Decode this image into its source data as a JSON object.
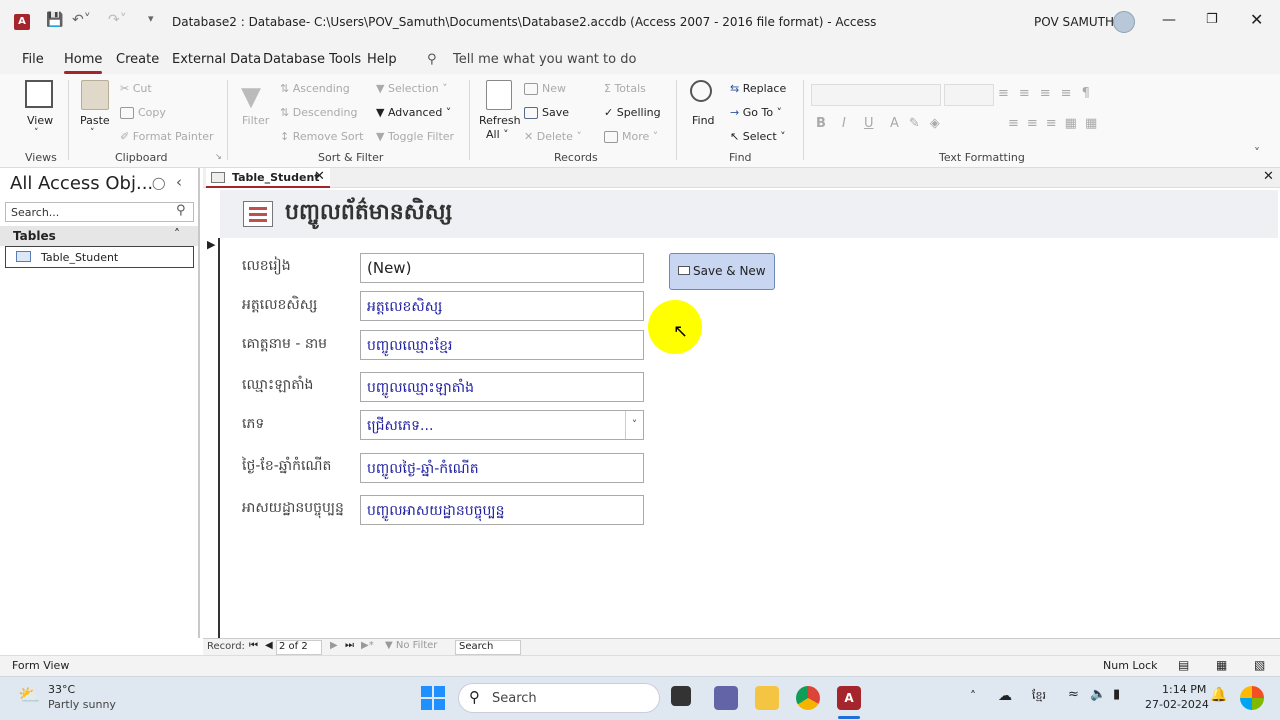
{
  "app": {
    "title": "Database2 : Database- C:\\Users\\POV_Samuth\\Documents\\Database2.accdb (Access 2007 - 2016 file format)  -  Access",
    "user": "POV SAMUTH",
    "icon_letter": "A"
  },
  "menu": {
    "items": [
      "File",
      "Home",
      "Create",
      "External Data",
      "Database Tools",
      "Help"
    ],
    "tell_me": "Tell me what you want to do"
  },
  "ribbon": {
    "views": {
      "view": "View",
      "group": "Views"
    },
    "clipboard": {
      "paste": "Paste",
      "cut": "Cut",
      "copy": "Copy",
      "format_painter": "Format Painter",
      "group": "Clipboard"
    },
    "sort_filter": {
      "filter": "Filter",
      "ascending": "Ascending",
      "descending": "Descending",
      "remove_sort": "Remove Sort",
      "selection": "Selection",
      "advanced": "Advanced",
      "toggle_filter": "Toggle Filter",
      "group": "Sort & Filter"
    },
    "records": {
      "refresh": "Refresh",
      "refresh_all": "All",
      "new": "New",
      "save": "Save",
      "delete": "Delete",
      "totals": "Totals",
      "spelling": "Spelling",
      "more": "More",
      "group": "Records"
    },
    "find": {
      "find": "Find",
      "replace": "Replace",
      "go_to": "Go To",
      "select": "Select",
      "group": "Find"
    },
    "text_formatting": {
      "group": "Text Formatting",
      "bold": "B",
      "italic": "I",
      "underline": "U"
    }
  },
  "nav": {
    "title": "All Access Obj...",
    "search_placeholder": "Search...",
    "section": "Tables",
    "items": [
      "Table_Student"
    ]
  },
  "document": {
    "tab": "Table_Student",
    "form_title": "បញ្ចូលព័ត៌មានសិស្ស"
  },
  "form": {
    "fields": [
      {
        "label": "លេខរៀង",
        "value": "(New)"
      },
      {
        "label": "អត្តលេខសិស្ស",
        "value": "អត្តលេខសិស្ស"
      },
      {
        "label": "គោត្តនាម - នាម",
        "value": "បញ្ចូលឈ្មោះខ្មែរ"
      },
      {
        "label": "ឈ្មោះឡាតាំង",
        "value": "បញ្ចូលឈ្មោះឡាតាំង"
      },
      {
        "label": "ភេទ",
        "value": "ជ្រើសភេទ..."
      },
      {
        "label": "ថ្ងៃ-ខែ-ឆ្នាំកំណើត",
        "value": "បញ្ចូលថ្ងៃ-ឆ្នាំ-កំណើត"
      },
      {
        "label": "អាសយដ្ឋានបច្ចុប្បន្ន",
        "value": "បញ្ចូលអាសយដ្ឋានបច្ចុប្បន្ន"
      }
    ],
    "save_new_button": "Save & New"
  },
  "record_nav": {
    "label": "Record:",
    "position": "2 of 2",
    "filter": "No Filter",
    "search": "Search"
  },
  "status": {
    "view": "Form View",
    "num_lock": "Num Lock"
  },
  "taskbar": {
    "weather_temp": "33°C",
    "weather_desc": "Partly sunny",
    "search": "Search",
    "language": "ខ្មែរ",
    "time": "1:14 PM",
    "date": "27-02-2024"
  },
  "colors": {
    "accent": "#a4262c",
    "field_text": "#1f1fa0",
    "button_bg": "#c9d6f2",
    "cursor_highlight": "#ffff00"
  }
}
